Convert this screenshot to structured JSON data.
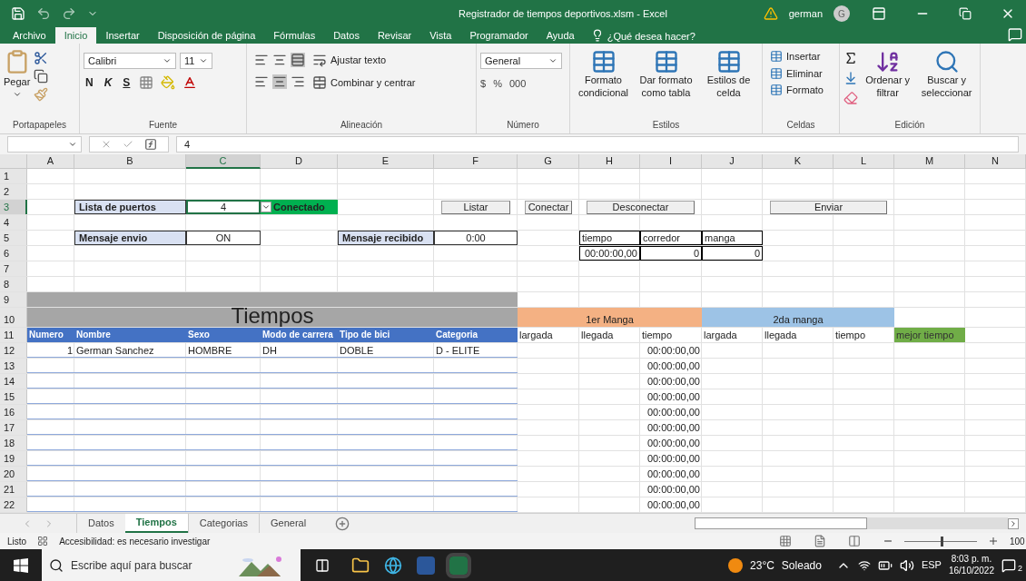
{
  "window": {
    "title": "Registrador de tiempos deportivos.xlsm  -  Excel",
    "user": "german",
    "avatar": "G"
  },
  "ribbon_tabs": [
    {
      "label": "Archivo",
      "selected": false
    },
    {
      "label": "Inicio",
      "selected": true
    },
    {
      "label": "Insertar",
      "selected": false
    },
    {
      "label": "Disposición de página",
      "selected": false
    },
    {
      "label": "Fórmulas",
      "selected": false
    },
    {
      "label": "Datos",
      "selected": false
    },
    {
      "label": "Revisar",
      "selected": false
    },
    {
      "label": "Vista",
      "selected": false
    },
    {
      "label": "Programador",
      "selected": false
    },
    {
      "label": "Ayuda",
      "selected": false
    }
  ],
  "tell_me": {
    "placeholder": "¿Qué desea hacer?"
  },
  "ribbon": {
    "groups": [
      {
        "kind": "clipboard",
        "label": "Portapapeles",
        "items": [
          "Pegar"
        ]
      },
      {
        "kind": "font",
        "label": "Fuente",
        "font": "Calibri",
        "size": "11",
        "items": [
          "N",
          "K",
          "S"
        ]
      },
      {
        "kind": "align",
        "label": "Alineación",
        "items": [
          "Ajustar texto",
          "Combinar y centrar"
        ]
      },
      {
        "kind": "number",
        "label": "Número",
        "format": "General",
        "items": [
          "$",
          "%",
          "000"
        ]
      },
      {
        "kind": "styles",
        "label": "Estilos",
        "items": [
          "Formato condicional",
          "Dar formato como tabla",
          "Estilos de celda"
        ]
      },
      {
        "kind": "cells",
        "label": "Celdas",
        "items": [
          "Insertar",
          "Eliminar",
          "Formato"
        ]
      },
      {
        "kind": "edit",
        "label": "Edición",
        "items": [
          "Ordenar y filtrar",
          "Buscar y seleccionar"
        ]
      }
    ]
  },
  "formula_bar": {
    "value": "4"
  },
  "columns": [
    {
      "label": "A",
      "selected": false
    },
    {
      "label": "B",
      "selected": false
    },
    {
      "label": "C",
      "selected": true
    },
    {
      "label": "D",
      "selected": false
    },
    {
      "label": "E",
      "selected": false
    },
    {
      "label": "F",
      "selected": false
    },
    {
      "label": "G",
      "selected": false
    },
    {
      "label": "H",
      "selected": false
    },
    {
      "label": "I",
      "selected": false
    },
    {
      "label": "J",
      "selected": false
    },
    {
      "label": "K",
      "selected": false
    },
    {
      "label": "L",
      "selected": false
    },
    {
      "label": "M",
      "selected": false
    },
    {
      "label": "N",
      "selected": false
    }
  ],
  "rows": [
    {
      "label": "1",
      "selected": false
    },
    {
      "label": "2",
      "selected": false
    },
    {
      "label": "3",
      "selected": true,
      "cells": [
        {
          "text": "Lista de puertos",
          "kind": "label"
        },
        {
          "text": "4",
          "kind": "value"
        },
        {
          "text": "Conectado",
          "kind": "status"
        },
        {
          "text": "Listar",
          "kind": "button"
        },
        {
          "text": "Conectar",
          "kind": "button"
        },
        {
          "text": "Desconectar",
          "kind": "button"
        },
        {
          "text": "Enviar",
          "kind": "button"
        }
      ]
    },
    {
      "label": "4",
      "selected": false
    },
    {
      "label": "5",
      "selected": false,
      "cells": [
        {
          "text": "Mensaje envio",
          "kind": "label"
        },
        {
          "text": "ON",
          "kind": "value"
        },
        {
          "text": "Mensaje recibido",
          "kind": "label"
        },
        {
          "text": "0:00",
          "kind": "value"
        },
        {
          "text": "tiempo",
          "kind": "box"
        },
        {
          "text": "corredor",
          "kind": "box"
        },
        {
          "text": "manga",
          "kind": "box"
        }
      ]
    },
    {
      "label": "6",
      "selected": false,
      "cells": [
        {
          "text": "00:00:00,00",
          "kind": "boxnum"
        },
        {
          "text": "0",
          "kind": "boxnum"
        },
        {
          "text": "0",
          "kind": "boxnum"
        }
      ]
    },
    {
      "label": "7",
      "selected": false
    },
    {
      "label": "8",
      "selected": false
    },
    {
      "label": "9",
      "selected": false
    },
    {
      "label": "10",
      "selected": false,
      "cells": [
        {
          "text": "Tiempos",
          "kind": "title"
        },
        {
          "text": "1er Manga",
          "kind": "band1"
        },
        {
          "text": "2da manga",
          "kind": "band2"
        }
      ]
    },
    {
      "label": "11",
      "selected": false,
      "cells": [
        {
          "text": "Numero",
          "kind": "head"
        },
        {
          "text": "Nombre",
          "kind": "head"
        },
        {
          "text": "Sexo",
          "kind": "head"
        },
        {
          "text": "Modo de carrera",
          "kind": "head"
        },
        {
          "text": "Tipo de bici",
          "kind": "head"
        },
        {
          "text": "Categoria",
          "kind": "head"
        },
        {
          "text": "largada",
          "kind": "text"
        },
        {
          "text": "llegada",
          "kind": "text"
        },
        {
          "text": "tiempo",
          "kind": "text"
        },
        {
          "text": "largada",
          "kind": "text"
        },
        {
          "text": "llegada",
          "kind": "text"
        },
        {
          "text": "tiempo",
          "kind": "text"
        },
        {
          "text": "mejor tiempo",
          "kind": "best"
        }
      ]
    },
    {
      "label": "12",
      "selected": false,
      "cells": [
        {
          "text": "1",
          "kind": "num"
        },
        {
          "text": "German Sanchez",
          "kind": "text"
        },
        {
          "text": "HOMBRE",
          "kind": "text"
        },
        {
          "text": "DH",
          "kind": "text"
        },
        {
          "text": "DOBLE",
          "kind": "text"
        },
        {
          "text": "D - ELITE",
          "kind": "text"
        },
        {
          "text": "00:00:00,00",
          "kind": "num"
        }
      ]
    },
    {
      "label": "13",
      "selected": false,
      "cells": [
        {
          "text": "00:00:00,00",
          "kind": "num"
        }
      ]
    },
    {
      "label": "14",
      "selected": false,
      "cells": [
        {
          "text": "00:00:00,00",
          "kind": "num"
        }
      ]
    },
    {
      "label": "15",
      "selected": false,
      "cells": [
        {
          "text": "00:00:00,00",
          "kind": "num"
        }
      ]
    },
    {
      "label": "16",
      "selected": false,
      "cells": [
        {
          "text": "00:00:00,00",
          "kind": "num"
        }
      ]
    },
    {
      "label": "17",
      "selected": false,
      "cells": [
        {
          "text": "00:00:00,00",
          "kind": "num"
        }
      ]
    },
    {
      "label": "18",
      "selected": false,
      "cells": [
        {
          "text": "00:00:00,00",
          "kind": "num"
        }
      ]
    },
    {
      "label": "19",
      "selected": false,
      "cells": [
        {
          "text": "00:00:00,00",
          "kind": "num"
        }
      ]
    },
    {
      "label": "20",
      "selected": false,
      "cells": [
        {
          "text": "00:00:00,00",
          "kind": "num"
        }
      ]
    },
    {
      "label": "21",
      "selected": false,
      "cells": [
        {
          "text": "00:00:00,00",
          "kind": "num"
        }
      ]
    },
    {
      "label": "22",
      "selected": false,
      "cells": [
        {
          "text": "00:00:00,00",
          "kind": "num"
        }
      ]
    }
  ],
  "sheet_tabs": [
    {
      "label": "Datos",
      "selected": false
    },
    {
      "label": "Tiempos",
      "selected": true
    },
    {
      "label": "Categorias",
      "selected": false
    },
    {
      "label": "General",
      "selected": false
    }
  ],
  "status_bar": {
    "mode": "Listo",
    "accessibility": "Accesibilidad: es necesario investigar",
    "zoom": "100",
    "zoom_slider": {
      "level": 0.5
    }
  },
  "taskbar": {
    "search": {
      "placeholder": "Escribe aquí para buscar"
    },
    "temperature": "23°C",
    "weather": "Soleado",
    "language": "ESP",
    "time": "8:03 p. m.",
    "date": "16/10/2022",
    "notifications": "2"
  }
}
